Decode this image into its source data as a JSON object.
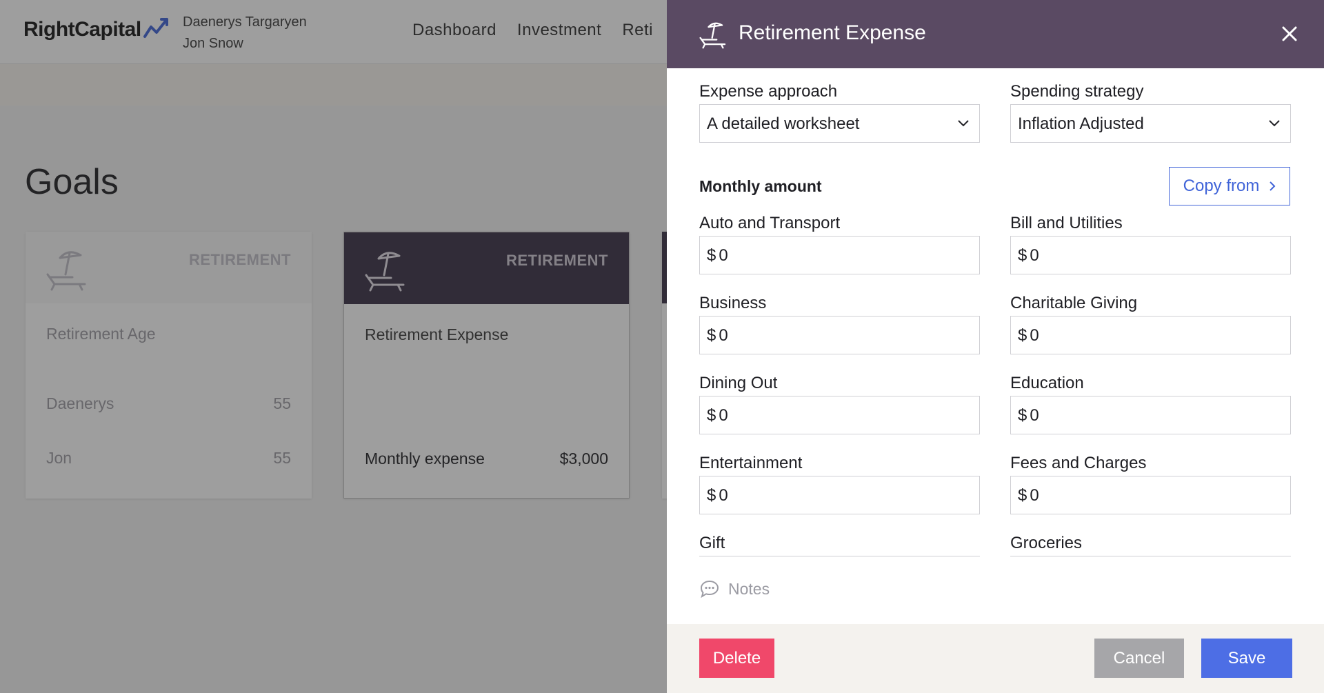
{
  "app": {
    "logo": "RightCapital",
    "clients": [
      "Daenerys Targaryen",
      "Jon Snow"
    ],
    "nav": [
      "Dashboard",
      "Investment",
      "Reti"
    ],
    "page_title": "Goals"
  },
  "cards": [
    {
      "category": "RETIREMENT",
      "title": "Retirement Age",
      "rows": [
        {
          "label": "Daenerys",
          "value": "55"
        },
        {
          "label": "Jon",
          "value": "55"
        }
      ]
    },
    {
      "category": "RETIREMENT",
      "title": "Retirement Expense",
      "rows": [
        {
          "label": "Monthly expense",
          "value": "$3,000"
        }
      ]
    }
  ],
  "drawer": {
    "title": "Retirement Expense",
    "icon": "beach-chair-icon",
    "expense_approach": {
      "label": "Expense approach",
      "value": "A detailed worksheet"
    },
    "spending_strategy": {
      "label": "Spending strategy",
      "value": "Inflation Adjusted"
    },
    "monthly_amount_title": "Monthly amount",
    "copy_from_label": "Copy from",
    "fields": [
      {
        "label": "Auto and Transport",
        "currency": "$",
        "value": "0"
      },
      {
        "label": "Bill and Utilities",
        "currency": "$",
        "value": "0"
      },
      {
        "label": "Business",
        "currency": "$",
        "value": "0"
      },
      {
        "label": "Charitable Giving",
        "currency": "$",
        "value": "0"
      },
      {
        "label": "Dining Out",
        "currency": "$",
        "value": "0"
      },
      {
        "label": "Education",
        "currency": "$",
        "value": "0"
      },
      {
        "label": "Entertainment",
        "currency": "$",
        "value": "0"
      },
      {
        "label": "Fees and Charges",
        "currency": "$",
        "value": "0"
      },
      {
        "label": "Gift"
      },
      {
        "label": "Groceries"
      }
    ],
    "notes_label": "Notes",
    "buttons": {
      "delete": "Delete",
      "cancel": "Cancel",
      "save": "Save"
    }
  },
  "colors": {
    "drawer_header": "#5a4a63",
    "card_header_active": "#3a3045",
    "primary": "#4d6ee5",
    "danger": "#f0486a"
  }
}
